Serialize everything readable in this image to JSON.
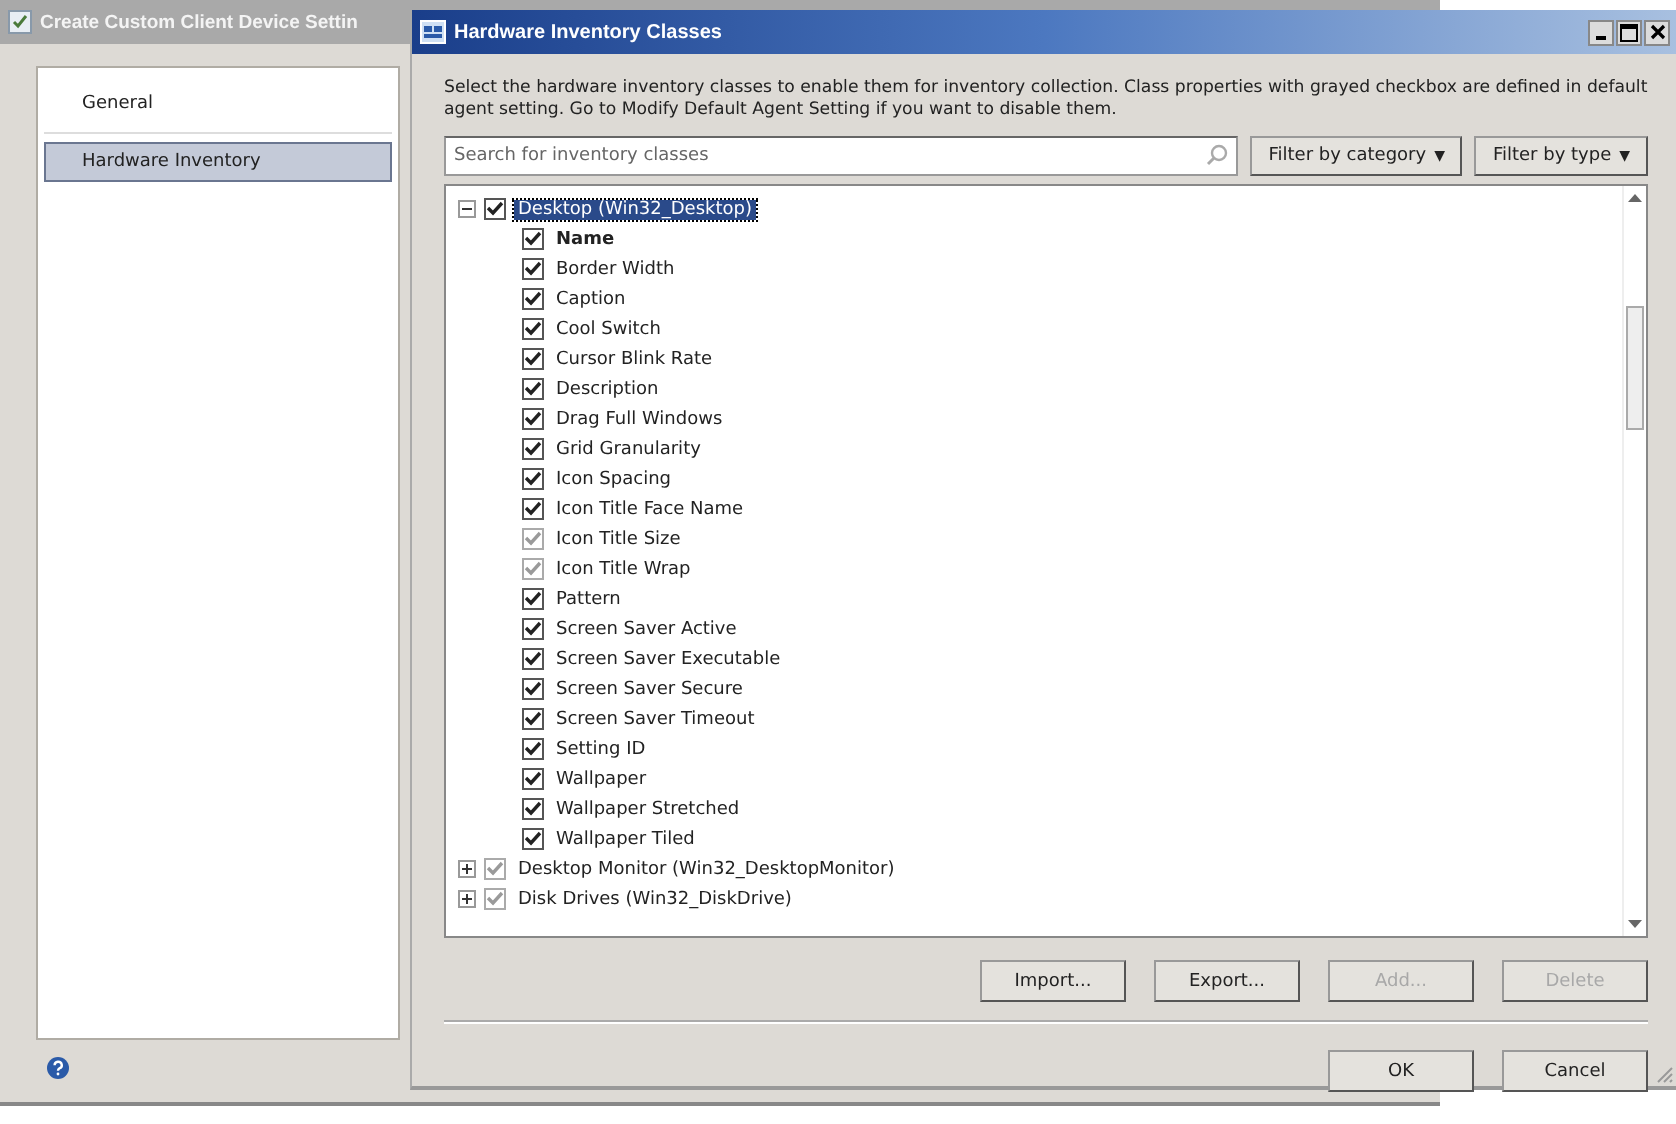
{
  "back_window": {
    "title": "Create Custom Client Device Settin",
    "nav_items": [
      {
        "label": "General",
        "selected": false
      },
      {
        "label": "Hardware Inventory",
        "selected": true
      }
    ]
  },
  "dialog": {
    "title": "Hardware Inventory Classes",
    "description": "Select the hardware inventory classes to enable them for inventory collection. Class properties with grayed checkbox are defined in default agent setting. Go to Modify Default Agent Setting if you want to disable them.",
    "search": {
      "placeholder": "Search for inventory classes"
    },
    "filters": [
      {
        "label": "Filter by category",
        "caret": "▼"
      },
      {
        "label": "Filter by type",
        "caret": "▼"
      }
    ],
    "classes": [
      {
        "label": "Desktop (Win32_Desktop)",
        "expanded": true,
        "checked": true,
        "disabled": false,
        "selected": true,
        "children": [
          {
            "label": "Name",
            "checked": true,
            "disabled": false,
            "key": true
          },
          {
            "label": "Border Width",
            "checked": true,
            "disabled": false,
            "key": false
          },
          {
            "label": "Caption",
            "checked": true,
            "disabled": false,
            "key": false
          },
          {
            "label": "Cool Switch",
            "checked": true,
            "disabled": false,
            "key": false
          },
          {
            "label": "Cursor Blink Rate",
            "checked": true,
            "disabled": false,
            "key": false
          },
          {
            "label": "Description",
            "checked": true,
            "disabled": false,
            "key": false
          },
          {
            "label": "Drag Full Windows",
            "checked": true,
            "disabled": false,
            "key": false
          },
          {
            "label": "Grid Granularity",
            "checked": true,
            "disabled": false,
            "key": false
          },
          {
            "label": "Icon Spacing",
            "checked": true,
            "disabled": false,
            "key": false
          },
          {
            "label": "Icon Title Face Name",
            "checked": true,
            "disabled": false,
            "key": false
          },
          {
            "label": "Icon Title Size",
            "checked": true,
            "disabled": true,
            "key": false
          },
          {
            "label": "Icon Title Wrap",
            "checked": true,
            "disabled": true,
            "key": false
          },
          {
            "label": "Pattern",
            "checked": true,
            "disabled": false,
            "key": false
          },
          {
            "label": "Screen Saver Active",
            "checked": true,
            "disabled": false,
            "key": false
          },
          {
            "label": "Screen Saver Executable",
            "checked": true,
            "disabled": false,
            "key": false
          },
          {
            "label": "Screen Saver Secure",
            "checked": true,
            "disabled": false,
            "key": false
          },
          {
            "label": "Screen Saver Timeout",
            "checked": true,
            "disabled": false,
            "key": false
          },
          {
            "label": "Setting ID",
            "checked": true,
            "disabled": false,
            "key": false
          },
          {
            "label": "Wallpaper",
            "checked": true,
            "disabled": false,
            "key": false
          },
          {
            "label": "Wallpaper Stretched",
            "checked": true,
            "disabled": false,
            "key": false
          },
          {
            "label": "Wallpaper Tiled",
            "checked": true,
            "disabled": false,
            "key": false
          }
        ]
      },
      {
        "label": "Desktop Monitor (Win32_DesktopMonitor)",
        "expanded": false,
        "checked": true,
        "disabled": true,
        "selected": false
      },
      {
        "label": "Disk Drives (Win32_DiskDrive)",
        "expanded": false,
        "checked": true,
        "disabled": true,
        "selected": false
      }
    ],
    "actions": [
      {
        "label": "Import...",
        "disabled": false
      },
      {
        "label": "Export...",
        "disabled": false
      },
      {
        "label": "Add...",
        "disabled": true
      },
      {
        "label": "Delete",
        "disabled": true
      }
    ],
    "buttons": [
      {
        "label": "OK"
      },
      {
        "label": "Cancel"
      }
    ]
  }
}
